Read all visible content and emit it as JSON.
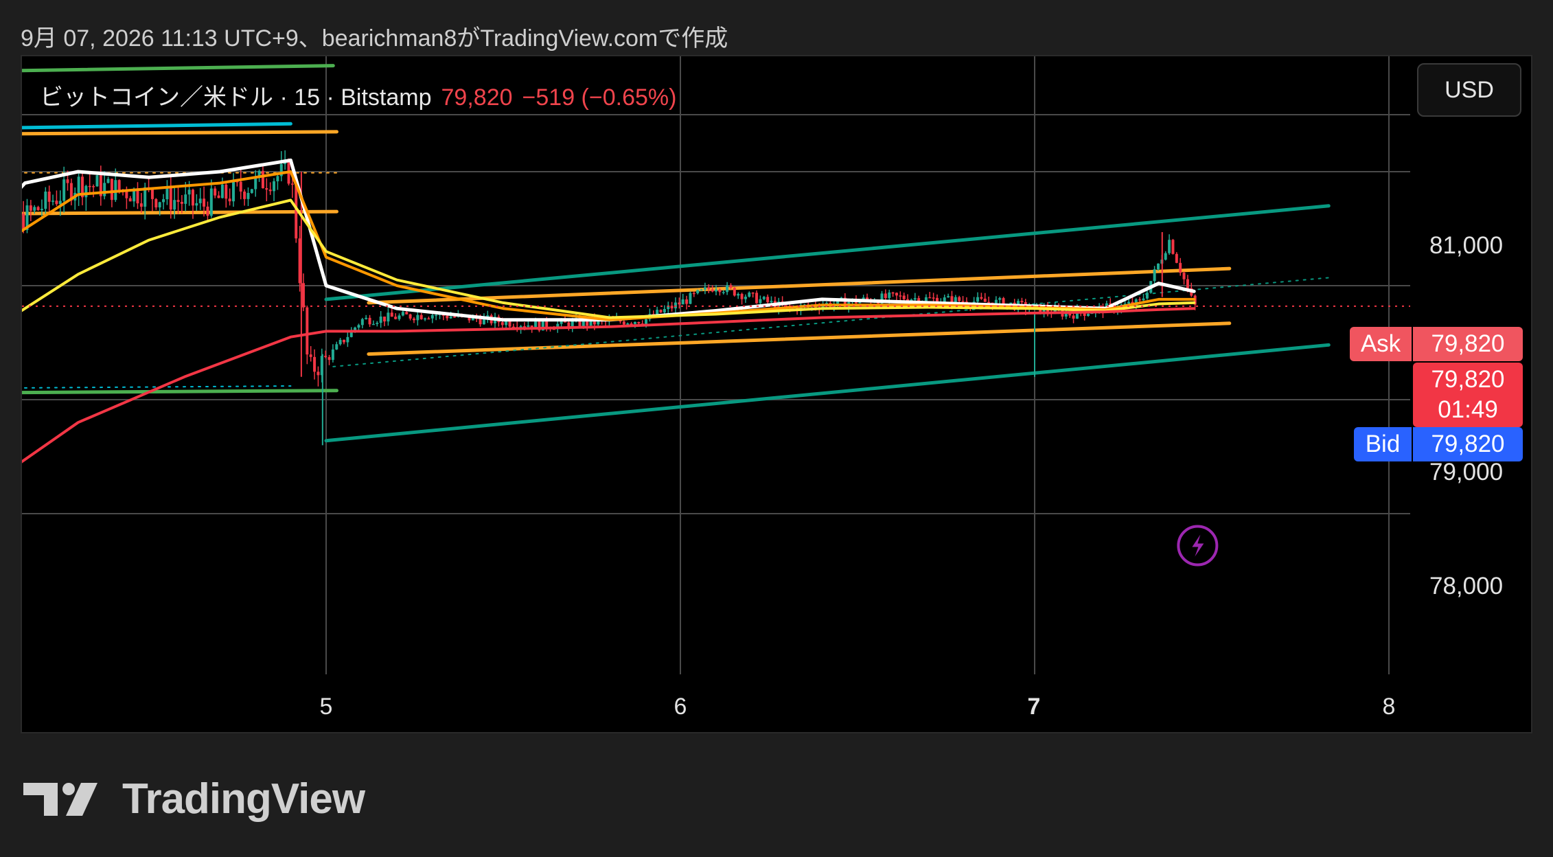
{
  "caption": "9月 07, 2026 11:13 UTC+9、bearichman8がTradingView.comで作成",
  "legend": {
    "symbol": "ビットコイン／米ドル · 15 · Bitstamp",
    "price": "79,820",
    "change": "−519 (−0.65%)"
  },
  "currency_button": "USD",
  "price_axis": [
    "81,000",
    "79,000",
    "78,000"
  ],
  "date_axis": [
    "5",
    "6",
    "7",
    "8"
  ],
  "ask": {
    "label": "Ask",
    "value": "79,820"
  },
  "last": {
    "value": "79,820",
    "countdown": "01:49"
  },
  "bid": {
    "label": "Bid",
    "value": "79,820"
  },
  "brand": "TradingView",
  "colors": {
    "up": "#22ab94",
    "down": "#f23645",
    "ask": "#f0555f",
    "last": "#f23645",
    "bid": "#2962ff",
    "ma_white": "#ffffff",
    "ma_yellow": "#ffeb3b",
    "ma_orange": "#ff9800",
    "ma_red": "#f23645",
    "channel": "#089981",
    "trendline": "#ffa726",
    "cyan": "#00bcd4",
    "green": "#4caf50",
    "alert": "#9c27b0"
  },
  "chart_data": {
    "type": "line",
    "title": "ビットコイン／米ドル · 15 · Bitstamp",
    "xlabel": "",
    "ylabel": "",
    "x_ticks": [
      "5",
      "6",
      "7",
      "8"
    ],
    "y_ticks": [
      78000,
      79000,
      81000
    ],
    "ylim": [
      77250,
      82000
    ],
    "grid": true,
    "legend_position": "top-left",
    "last_price": 79820,
    "series": [
      {
        "x": [
          4.0,
          4.15,
          4.3,
          4.5,
          4.65,
          4.8,
          4.9,
          4.95,
          5.0,
          5.1,
          5.3,
          5.6,
          5.9,
          6.1,
          6.3,
          6.6,
          6.9,
          7.1,
          7.3,
          7.38,
          7.45
        ],
        "values": [
          80250,
          80600,
          80900,
          80800,
          80700,
          80900,
          81000,
          79250,
          79350,
          79700,
          79750,
          79650,
          79700,
          80000,
          79800,
          79900,
          79850,
          79750,
          79850,
          80400,
          79820
        ]
      },
      {
        "x": [
          4.0,
          4.15,
          4.3,
          4.5,
          4.7,
          4.9,
          5.0,
          5.2,
          5.5,
          5.8,
          6.1,
          6.4,
          6.7,
          7.0,
          7.2,
          7.35,
          7.45
        ],
        "values": [
          80400,
          80900,
          81000,
          80950,
          81000,
          81100,
          80000,
          79800,
          79700,
          79700,
          79780,
          79880,
          79850,
          79820,
          79800,
          80020,
          79950
        ]
      },
      {
        "x": [
          4.0,
          4.1,
          4.3,
          4.5,
          4.7,
          4.9,
          5.0,
          5.2,
          5.5,
          5.8,
          6.1,
          6.4,
          6.7,
          7.0,
          7.2,
          7.35,
          7.45
        ],
        "values": [
          79900,
          80400,
          80800,
          80850,
          80900,
          81000,
          80250,
          80000,
          79800,
          79700,
          79760,
          79830,
          79830,
          79810,
          79790,
          79880,
          79880
        ]
      },
      {
        "x": [
          4.0,
          4.1,
          4.3,
          4.5,
          4.7,
          4.9,
          5.0,
          5.2,
          5.5,
          5.8,
          6.1,
          6.4,
          6.7,
          7.0,
          7.2,
          7.35,
          7.45
        ],
        "values": [
          79250,
          79700,
          80100,
          80400,
          80600,
          80750,
          80300,
          80050,
          79850,
          79720,
          79750,
          79800,
          79810,
          79800,
          79780,
          79840,
          79850
        ]
      },
      {
        "x": [
          4.0,
          4.3,
          4.6,
          4.9,
          5.0,
          5.2,
          5.5,
          5.8,
          6.1,
          6.4,
          6.7,
          7.0,
          7.2,
          7.35,
          7.45
        ],
        "values": [
          78150,
          78800,
          79200,
          79550,
          79600,
          79600,
          79620,
          79640,
          79680,
          79720,
          79740,
          79760,
          79770,
          79790,
          79800
        ]
      }
    ]
  }
}
